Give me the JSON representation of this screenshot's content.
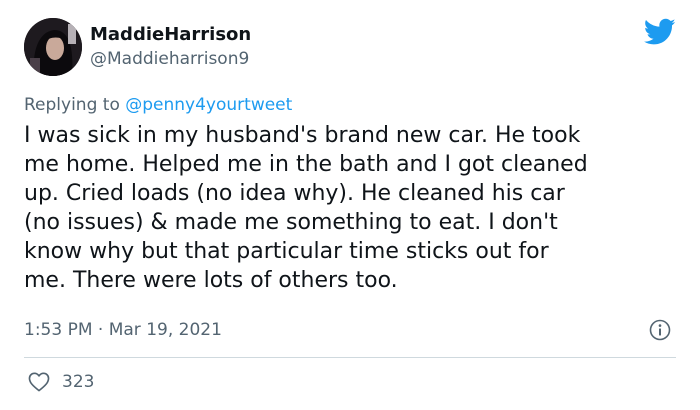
{
  "author": {
    "display_name": "MaddieHarrison",
    "handle": "@Maddieharrison9"
  },
  "reply": {
    "prefix": "Replying to ",
    "mention": "@penny4yourtweet"
  },
  "tweet": {
    "lines": [
      "I was sick in my husband's brand new car. He took",
      "me home. Helped me in the bath and I got cleaned",
      "up. Cried loads (no idea why). He cleaned his car",
      "(no issues) & made me something to eat. I don't",
      "know why but that particular time sticks out for",
      "me. There were lots of others too."
    ],
    "timestamp": "1:53 PM · Mar 19, 2021"
  },
  "actions": {
    "like_count": "323"
  },
  "icons": {
    "brand": "twitter-bird-icon",
    "info": "info-icon",
    "like": "heart-icon"
  },
  "colors": {
    "brand_blue": "#1d9bf0",
    "text_primary": "#0f1419",
    "text_secondary": "#536471",
    "divider": "#cfd9de"
  }
}
